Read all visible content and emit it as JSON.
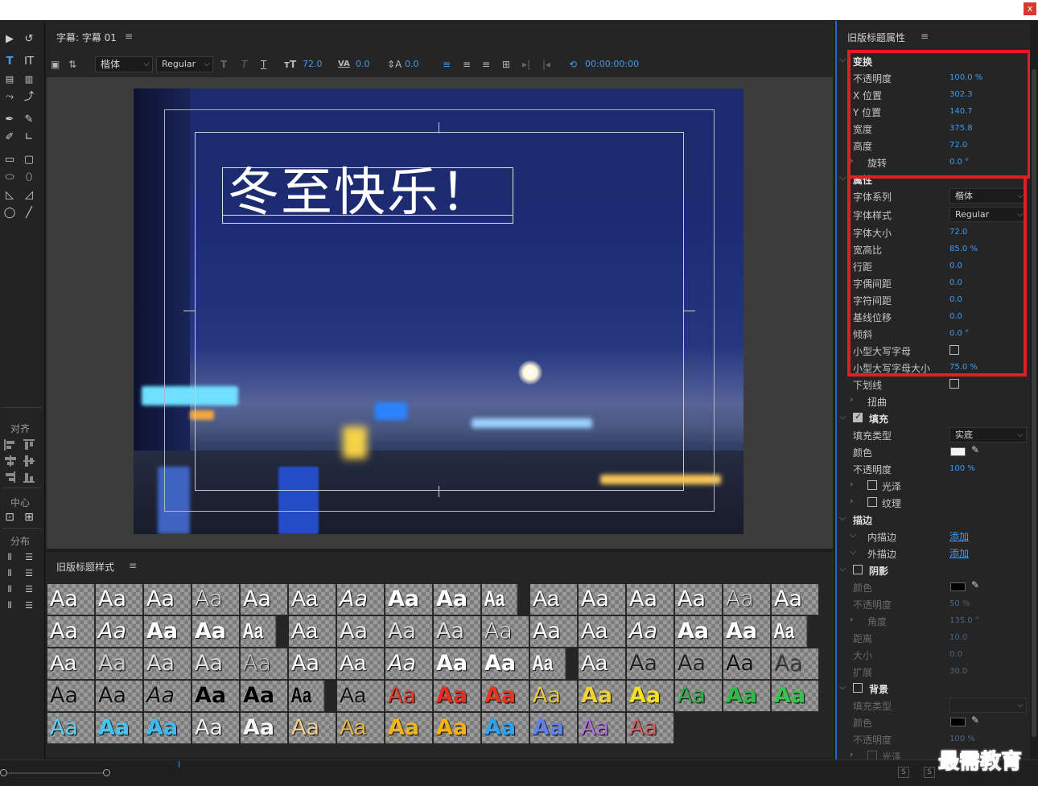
{
  "window": {
    "close_glyph": "x"
  },
  "title_panel": {
    "tab": "字幕: 字幕 01",
    "menu": "≡",
    "toolbar": {
      "font_family": "楷体",
      "font_style": "Regular",
      "font_size": "72.0",
      "kerning": "0.0",
      "leading": "0.0",
      "timecode": "00:00:00:00"
    },
    "title_text": "冬至快乐！"
  },
  "tools_panel": {
    "align_label": "对齐",
    "center_label": "中心",
    "distribute_label": "分布"
  },
  "styles_panel": {
    "tab": "旧版标题样式",
    "menu": "≡",
    "swatch_text": "Aa"
  },
  "props_panel": {
    "tab": "旧版标题属性",
    "menu": "≡",
    "transform": {
      "title": "变换",
      "opacity_label": "不透明度",
      "opacity": "100.0 %",
      "x_label": "X 位置",
      "x": "302.3",
      "y_label": "Y 位置",
      "y": "140.7",
      "width_label": "宽度",
      "width": "375.8",
      "height_label": "高度",
      "height": "72.0",
      "rotation_label": "旋转",
      "rotation": "0.0 °"
    },
    "properties": {
      "title": "属性",
      "font_family_label": "字体系列",
      "font_family": "楷体",
      "font_style_label": "字体样式",
      "font_style": "Regular",
      "font_size_label": "字体大小",
      "font_size": "72.0",
      "aspect_label": "宽高比",
      "aspect": "85.0 %",
      "leading_label": "行距",
      "leading": "0.0",
      "kerning_label": "字偶间距",
      "kerning": "0.0",
      "tracking_label": "字符间距",
      "tracking": "0.0",
      "baseline_label": "基线位移",
      "baseline": "0.0",
      "slant_label": "倾斜",
      "slant": "0.0 °",
      "small_caps_label": "小型大写字母",
      "small_caps_size_label": "小型大写字母大小",
      "small_caps_size": "75.0 %",
      "underline_label": "下划线",
      "distort_label": "扭曲"
    },
    "fill": {
      "title": "填充",
      "type_label": "填充类型",
      "type": "实底",
      "color_label": "颜色",
      "color": "#f2f2f2",
      "opacity_label": "不透明度",
      "opacity": "100 %",
      "sheen_label": "光泽",
      "texture_label": "纹理"
    },
    "stroke": {
      "title": "描边",
      "inner_label": "内描边",
      "inner_action": "添加",
      "outer_label": "外描边",
      "outer_action": "添加"
    },
    "shadow": {
      "title": "阴影",
      "color_label": "颜色",
      "color": "#000000",
      "opacity_label": "不透明度",
      "opacity": "50 %",
      "angle_label": "角度",
      "angle": "135.0 °",
      "distance_label": "距离",
      "distance": "10.0",
      "size_label": "大小",
      "size": "0.0",
      "spread_label": "扩展",
      "spread": "30.0"
    },
    "background": {
      "title": "背景",
      "type_label": "填充类型",
      "color_label": "颜色",
      "color": "#000000",
      "opacity_label": "不透明度",
      "opacity": "100 %",
      "sheen_label": "光泽"
    }
  },
  "bottom": {
    "s_label": "S"
  },
  "watermark": "最需教育"
}
